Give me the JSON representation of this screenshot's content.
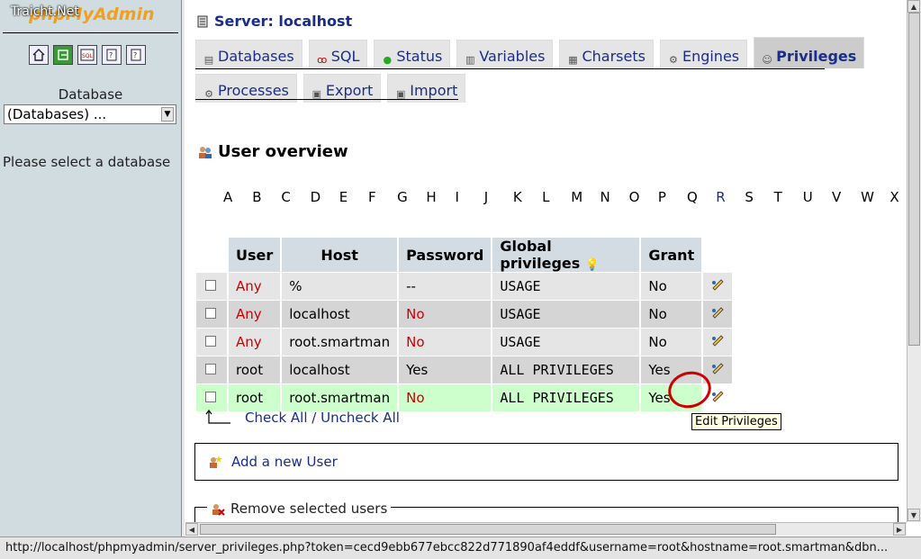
{
  "left": {
    "watermark": "Traicht.Net",
    "brand": "phpMyAdmin",
    "db_label": "Database",
    "db_select_value": "(Databases) ...",
    "please_select": "Please select a database",
    "quick_icons": [
      "home-icon",
      "exit-icon",
      "sql-query-icon",
      "query-window-icon",
      "docs-icon"
    ]
  },
  "main": {
    "server_title": "Server: localhost",
    "tabs_row1": [
      {
        "label": "Databases",
        "icon": "databases-icon"
      },
      {
        "label": "SQL",
        "icon": "sql-icon"
      },
      {
        "label": "Status",
        "icon": "status-icon"
      },
      {
        "label": "Variables",
        "icon": "variables-icon"
      },
      {
        "label": "Charsets",
        "icon": "charsets-icon"
      },
      {
        "label": "Engines",
        "icon": "engines-icon"
      },
      {
        "label": "Privileges",
        "icon": "privileges-icon",
        "active": true
      }
    ],
    "tabs_row2": [
      {
        "label": "Processes",
        "icon": "processes-icon"
      },
      {
        "label": "Export",
        "icon": "export-icon"
      },
      {
        "label": "Import",
        "icon": "import-icon"
      }
    ],
    "user_overview": "User overview",
    "letters": [
      "A",
      "B",
      "C",
      "D",
      "E",
      "F",
      "G",
      "H",
      "I",
      "J",
      "K",
      "L",
      "M",
      "N",
      "O",
      "P",
      "Q",
      "R",
      "S",
      "T",
      "U",
      "V",
      "W",
      "X"
    ],
    "linked_letter": "R",
    "table": {
      "headers": {
        "user": "User",
        "host": "Host",
        "password": "Password",
        "global_privileges": "Global privileges",
        "grant": "Grant"
      },
      "rows": [
        {
          "user": "Any",
          "host": "%",
          "password": "--",
          "privileges": "USAGE",
          "grant": "No"
        },
        {
          "user": "Any",
          "host": "localhost",
          "password": "No",
          "privileges": "USAGE",
          "grant": "No"
        },
        {
          "user": "Any",
          "host": "root.smartman",
          "password": "No",
          "privileges": "USAGE",
          "grant": "No"
        },
        {
          "user": "root",
          "host": "localhost",
          "password": "Yes",
          "privileges": "ALL PRIVILEGES",
          "grant": "Yes"
        },
        {
          "user": "root",
          "host": "root.smartman",
          "password": "No",
          "privileges": "ALL PRIVILEGES",
          "grant": "Yes"
        }
      ]
    },
    "check_all": "Check All",
    "separator": "/",
    "uncheck_all": "Uncheck All",
    "tooltip": "Edit Privileges",
    "add_user": "Add a new User",
    "remove_users": "Remove selected users"
  },
  "statusbar": "http://localhost/phpmyadmin/server_privileges.php?token=cecd9ebb677ebcc822d771890af4eddf&username=root&hostname=root.smartman&dbn...",
  "colors": {
    "link": "#1a2d8a",
    "red_value": "#cc0000",
    "highlight_row": "#ccffcc",
    "nav_bg": "#d0dce0",
    "header_bg": "#d3dce3"
  }
}
